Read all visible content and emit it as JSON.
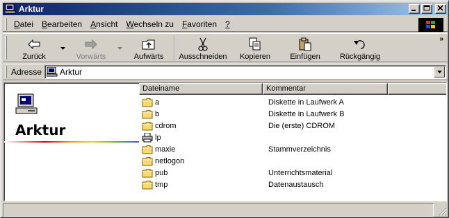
{
  "window": {
    "title": "Arktur",
    "title_icon": "computer-icon"
  },
  "window_controls": [
    "minimize-icon",
    "maximize-icon",
    "close-icon"
  ],
  "menu": {
    "items": [
      {
        "label": "Datei",
        "mnemonic": "D"
      },
      {
        "label": "Bearbeiten",
        "mnemonic": "B"
      },
      {
        "label": "Ansicht",
        "mnemonic": "A"
      },
      {
        "label": "Wechseln zu",
        "mnemonic": "W"
      },
      {
        "label": "Favoriten",
        "mnemonic": "F"
      },
      {
        "label": "?",
        "mnemonic": "?"
      }
    ]
  },
  "toolbar": {
    "back": "Zurück",
    "forward": "Vorwärts",
    "up": "Aufwärts",
    "cut": "Ausschneiden",
    "copy": "Kopieren",
    "paste": "Einfügen",
    "undo": "Rückgängig",
    "more": "»"
  },
  "address": {
    "label": "Adresse",
    "value": "Arktur"
  },
  "left_pane": {
    "title": "Arktur"
  },
  "list": {
    "columns": [
      "Dateiname",
      "Kommentar"
    ],
    "rows": [
      {
        "name": "a",
        "comment": "Diskette in Laufwerk A",
        "icon": "folder-icon"
      },
      {
        "name": "b",
        "comment": "Diskette in Laufwerk B",
        "icon": "folder-icon"
      },
      {
        "name": "cdrom",
        "comment": "Die (erste) CDROM",
        "icon": "folder-icon"
      },
      {
        "name": "lp",
        "comment": "",
        "icon": "printer-icon"
      },
      {
        "name": "maxie",
        "comment": "Stammverzeichnis",
        "icon": "folder-icon"
      },
      {
        "name": "netlogon",
        "comment": "",
        "icon": "folder-icon"
      },
      {
        "name": "pub",
        "comment": "Unterrichtsmaterial",
        "icon": "folder-icon"
      },
      {
        "name": "tmp",
        "comment": "Datenaustausch",
        "icon": "folder-icon"
      }
    ]
  },
  "colors": {
    "titlebar_start": "#0a246a",
    "titlebar_end": "#a6caf0",
    "face": "#d4d0c8",
    "folder": "#f8d870"
  }
}
